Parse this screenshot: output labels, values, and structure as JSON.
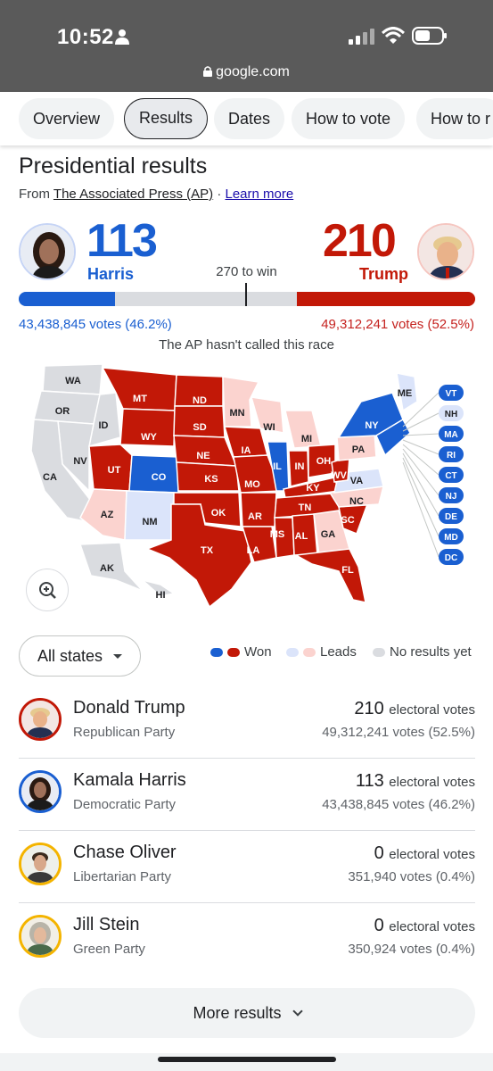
{
  "status_bar": {
    "time": "10:52"
  },
  "browser": {
    "url": "google.com"
  },
  "tabs": [
    {
      "label": "Overview"
    },
    {
      "label": "Results"
    },
    {
      "label": "Dates"
    },
    {
      "label": "How to vote"
    },
    {
      "label": "How to r"
    }
  ],
  "header": {
    "title": "Presidential results",
    "from_prefix": "From",
    "source": "The Associated Press (AP)",
    "separator": "·",
    "learn_more": "Learn more"
  },
  "summary": {
    "harris": {
      "ev": "113",
      "name": "Harris",
      "votes": "43,438,845 votes (46.2%)",
      "color": "#1a5fd1"
    },
    "trump": {
      "ev": "210",
      "name": "Trump",
      "votes": "49,312,241 votes (52.5%)",
      "color": "#c21807"
    },
    "to_win": "270 to win",
    "total_ev": 538,
    "status": "The AP hasn't called this race"
  },
  "map": {
    "state_labels": [
      "WA",
      "OR",
      "ID",
      "MT",
      "ND",
      "SD",
      "WY",
      "NV",
      "CA",
      "UT",
      "CO",
      "NE",
      "KS",
      "AZ",
      "NM",
      "OK",
      "TX",
      "MN",
      "IA",
      "MO",
      "AR",
      "LA",
      "WI",
      "IL",
      "MI",
      "IN",
      "OH",
      "KY",
      "TN",
      "MS",
      "AL",
      "GA",
      "FL",
      "SC",
      "NC",
      "VA",
      "WV",
      "PA",
      "NY",
      "ME",
      "AK",
      "HI"
    ],
    "callouts": [
      "VT",
      "NH",
      "MA",
      "RI",
      "CT",
      "NJ",
      "DE",
      "MD",
      "DC"
    ],
    "colors": {
      "dem_won": "#1a5fd1",
      "rep_won": "#c21807",
      "dem_leads": "#dbe4fa",
      "rep_leads": "#fbd3cf",
      "no_results": "#dadce0"
    }
  },
  "filter": {
    "label": "All states"
  },
  "legend": {
    "won": "Won",
    "leads": "Leads",
    "no_results": "No results yet"
  },
  "candidates": [
    {
      "name": "Donald Trump",
      "party": "Republican Party",
      "ev": "210",
      "ev_label": "electoral votes",
      "votes": "49,312,241 votes (52.5%)",
      "ring": "#c21807"
    },
    {
      "name": "Kamala Harris",
      "party": "Democratic Party",
      "ev": "113",
      "ev_label": "electoral votes",
      "votes": "43,438,845 votes (46.2%)",
      "ring": "#1a5fd1"
    },
    {
      "name": "Chase Oliver",
      "party": "Libertarian Party",
      "ev": "0",
      "ev_label": "electoral votes",
      "votes": "351,940 votes (0.4%)",
      "ring": "#f4b400"
    },
    {
      "name": "Jill Stein",
      "party": "Green Party",
      "ev": "0",
      "ev_label": "electoral votes",
      "votes": "350,924 votes (0.4%)",
      "ring": "#f4b400"
    }
  ],
  "more_results": "More results"
}
